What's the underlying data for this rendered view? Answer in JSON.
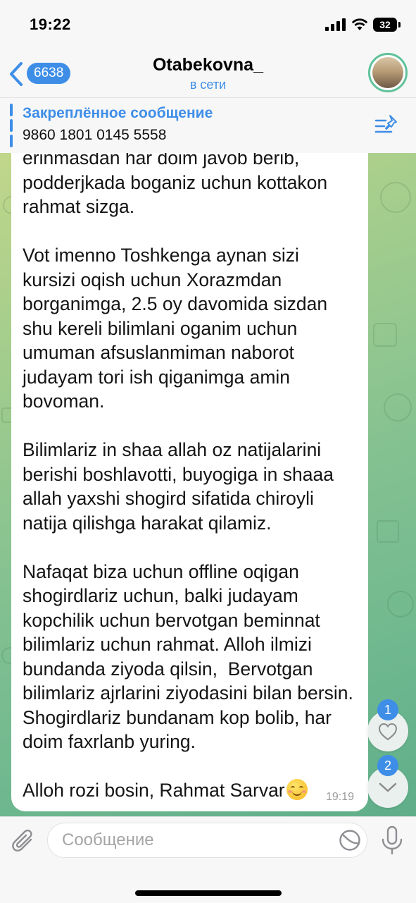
{
  "status_bar": {
    "time": "19:22",
    "battery": "32"
  },
  "header": {
    "back_count": "6638",
    "title": "Otabekovna_",
    "status": "в сети"
  },
  "pinned": {
    "label": "Закреплённое сообщение",
    "text": "9860 1801 0145 5558"
  },
  "message": {
    "text": "erinmasdan har doim javob berib,\npodderjkada boganiz uchun kottakon\nrahmat sizga.\n\nVot imenno Toshkenga aynan sizi\nkursizi oqish uchun Xorazmdan\nborganimga, 2.5 oy davomida sizdan\nshu kereli bilimlani oganim uchun\numuman afsuslanmiman naborot\njudayam tori ish qiganimga amin\nbovoman.\n\nBilimlariz in shaa allah oz natijalarini\nberishi boshlavotti, buyogiga in shaaa\nallah yaxshi shogird sifatida chiroyli\nnatija qilishga harakat qilamiz.\n\nNafaqat biza uchun offline oqigan\nshogirdlariz uchun, balki judayam\nkopchilik uchun bervotgan beminnat\nbilimlariz uchun rahmat. Alloh ilmizi\nbundanda ziyoda qilsin,  Bervotgan\nbilimlariz ajrlarini ziyodasini bilan bersin.\nShogirdlariz bundanam kop bolib, har\ndoim faxrlanb yuring.\n\nAlloh rozi bosin, Rahmat Sarvar",
    "emoji": "smiling-face-icon",
    "time": "19:19"
  },
  "floating": {
    "reactions_count": "1",
    "unread_count": "2"
  },
  "input": {
    "placeholder": "Сообщение",
    "value": ""
  },
  "colors": {
    "accent": "#3e8ee8",
    "wallpaper_start": "#c9d98a",
    "wallpaper_end": "#5fae8a"
  }
}
